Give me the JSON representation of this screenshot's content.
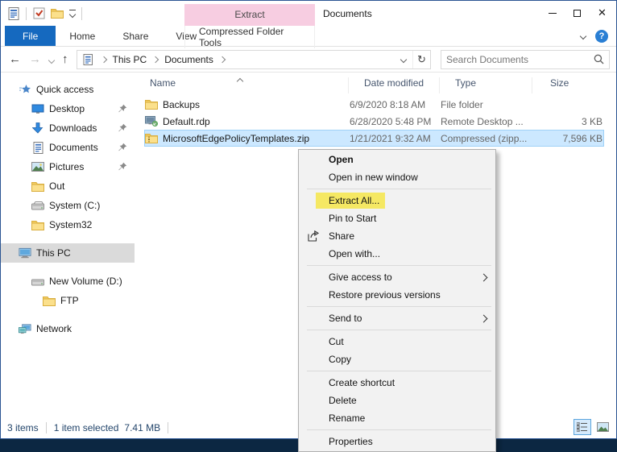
{
  "window": {
    "title": "Documents"
  },
  "titlebar": {
    "qat_icons": [
      "documents-icon",
      "checkbox-icon",
      "new-folder-icon",
      "customize-quick-access-dropdown"
    ],
    "contextual_group": "Extract",
    "controls": {
      "minimize": "minimize",
      "maximize": "maximize",
      "close": "close"
    }
  },
  "ribbon": {
    "tabs": [
      {
        "label": "File"
      },
      {
        "label": "Home"
      },
      {
        "label": "Share"
      },
      {
        "label": "View"
      },
      {
        "label": "Compressed Folder Tools"
      }
    ],
    "collapse_icon": "chevron-down-icon",
    "help_icon": "?"
  },
  "nav": {
    "back": "back-arrow",
    "forward": "forward-arrow",
    "up": "up-arrow",
    "breadcrumb": [
      "This PC",
      "Documents"
    ],
    "refresh_icon": "refresh",
    "search_placeholder": "Search Documents"
  },
  "sidebar": {
    "items": [
      {
        "label": "Quick access",
        "icon": "quick-access-star",
        "indent": 0,
        "pinned": false,
        "selected": false
      },
      {
        "label": "Desktop",
        "icon": "desktop",
        "indent": 1,
        "pinned": true,
        "selected": false
      },
      {
        "label": "Downloads",
        "icon": "downloads-arrow",
        "indent": 1,
        "pinned": true,
        "selected": false
      },
      {
        "label": "Documents",
        "icon": "document",
        "indent": 1,
        "pinned": true,
        "selected": false
      },
      {
        "label": "Pictures",
        "icon": "picture",
        "indent": 1,
        "pinned": true,
        "selected": false
      },
      {
        "label": "Out",
        "icon": "folder",
        "indent": 1,
        "pinned": false,
        "selected": false
      },
      {
        "label": "System (C:)",
        "icon": "drive",
        "indent": 1,
        "pinned": false,
        "selected": false
      },
      {
        "label": "System32",
        "icon": "folder",
        "indent": 1,
        "pinned": false,
        "selected": false
      },
      {
        "label": "This PC",
        "icon": "computer",
        "indent": 0,
        "pinned": false,
        "selected": true
      },
      {
        "label": "New Volume (D:)",
        "icon": "drive",
        "indent": 1,
        "pinned": false,
        "selected": false
      },
      {
        "label": "FTP",
        "icon": "folder",
        "indent": 2,
        "pinned": false,
        "selected": false
      },
      {
        "label": "Network",
        "icon": "network",
        "indent": 0,
        "pinned": false,
        "selected": false
      }
    ]
  },
  "files": {
    "columns": [
      "Name",
      "Date modified",
      "Type",
      "Size"
    ],
    "sort": {
      "column": "Name",
      "direction": "ascending"
    },
    "rows": [
      {
        "name": "Backups",
        "icon": "folder",
        "date": "6/9/2020 8:18 AM",
        "type": "File folder",
        "size": "",
        "selected": false
      },
      {
        "name": "Default.rdp",
        "icon": "rdp-file",
        "date": "6/28/2020 5:48 PM",
        "type": "Remote Desktop ...",
        "size": "3 KB",
        "selected": false
      },
      {
        "name": "MicrosoftEdgePolicyTemplates.zip",
        "icon": "zip-folder",
        "date": "1/21/2021 9:32 AM",
        "type": "Compressed (zipp...",
        "size": "7,596 KB",
        "selected": true
      }
    ]
  },
  "context_menu": {
    "items": [
      {
        "label": "Open",
        "bold": true
      },
      {
        "label": "Open in new window"
      },
      {
        "label": "Extract All...",
        "highlighted": true
      },
      {
        "label": "Pin to Start"
      },
      {
        "label": "Share",
        "icon": "share-icon"
      },
      {
        "label": "Open with..."
      },
      {
        "label": "Give access to",
        "submenu": true
      },
      {
        "label": "Restore previous versions"
      },
      {
        "label": "Send to",
        "submenu": true
      },
      {
        "label": "Cut"
      },
      {
        "label": "Copy"
      },
      {
        "label": "Create shortcut"
      },
      {
        "label": "Delete"
      },
      {
        "label": "Rename"
      },
      {
        "label": "Properties"
      }
    ]
  },
  "statusbar": {
    "items_count": "3 items",
    "selection_count": "1 item selected",
    "selection_size": "7.41 MB",
    "view_buttons": [
      "details-view",
      "thumbnail-view"
    ]
  },
  "colors": {
    "accent_blue": "#1569bf",
    "selection_fill": "#cce8ff",
    "selection_border": "#9fd1f7",
    "highlight_yellow": "#f5e863",
    "contextual_pink": "#f7cde1",
    "desktop_background": "#0c2742",
    "window_border": "#2a5492"
  }
}
